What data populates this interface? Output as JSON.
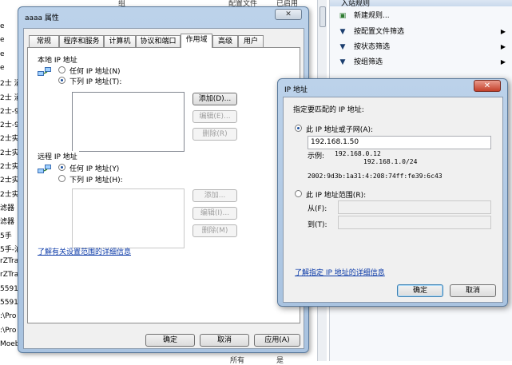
{
  "background": {
    "left_rows": [
      "e",
      "e",
      "e",
      "e",
      "2士 涌",
      "2士 涌",
      "2士-9",
      "2士-9",
      "2士实",
      "2士实",
      "2士实",
      "2士实",
      "2士实",
      "滤器",
      "滤器",
      "5手",
      "5手-泊",
      "rZTra",
      "rZTra",
      "5591",
      "5591",
      ":\\Pro",
      ":\\Pro",
      "Moeb"
    ],
    "column_headers": [
      "组",
      "配置文件",
      "已启用"
    ],
    "actions_header": "入站规则",
    "actions": [
      {
        "icon": "new-rule-icon",
        "label": "新建规则...",
        "arrow": ""
      },
      {
        "icon": "filter-icon",
        "label": "按配置文件筛选",
        "arrow": "▶"
      },
      {
        "icon": "filter-icon",
        "label": "按状态筛选",
        "arrow": "▶"
      },
      {
        "icon": "filter-icon",
        "label": "按组筛选",
        "arrow": "▶"
      }
    ],
    "bottom_cells": [
      "所有",
      "是"
    ]
  },
  "properties_dialog": {
    "title": "aaaa 属性",
    "close_glyph": "✕",
    "tabs": [
      "常规",
      "程序和服务",
      "计算机",
      "协议和端口",
      "作用域",
      "高级",
      "用户"
    ],
    "active_tab": "作用域",
    "local": {
      "label": "本地 IP 地址",
      "option_any": "任何 IP 地址(N)",
      "option_list": "下列 IP 地址(T):",
      "selected": "list",
      "add": "添加(D)...",
      "edit": "编辑(E)...",
      "delete": "删除(R)"
    },
    "remote": {
      "label": "远程 IP 地址",
      "option_any": "任何 IP 地址(Y)",
      "option_list": "下列 IP 地址(H):",
      "selected": "any",
      "add": "添加...",
      "edit": "编辑(I)...",
      "delete": "删除(M)"
    },
    "help_link": "了解有关设置范围的详细信息",
    "ok": "确定",
    "cancel": "取消",
    "apply": "应用(A)"
  },
  "ip_dialog": {
    "title": "IP 地址",
    "close_glyph": "✕",
    "prompt": "指定要匹配的 IP 地址:",
    "option_subnet": "此 IP 地址或子网(A):",
    "subnet_value": "192.168.1.50",
    "example_label": "示例:",
    "example_1": "192.168.0.12",
    "example_2": "192.168.1.0/24",
    "example_3": "2002:9d3b:1a31:4:208:74ff:fe39:6c43",
    "option_range": "此 IP 地址范围(R):",
    "from_label": "从(F):",
    "to_label": "到(T):",
    "selected": "subnet",
    "help_link": "了解指定 IP 地址的详细信息",
    "ok": "确定",
    "cancel": "取消"
  }
}
